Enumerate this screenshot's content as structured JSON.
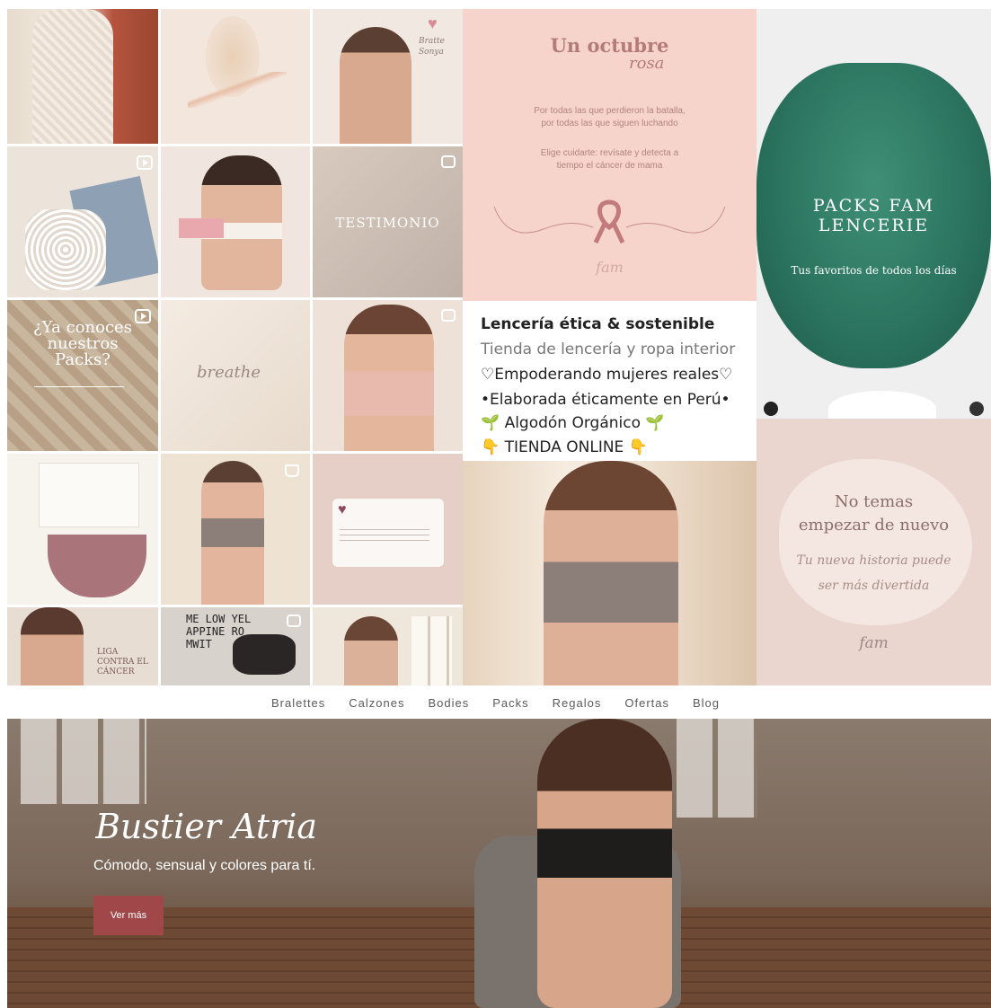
{
  "grid_text": {
    "testimonio": "TESTIMONIO",
    "packs_q": "¿Ya conoces nuestros Packs?",
    "breathe": "breathe",
    "liga": "LIGA CONTRA EL CÁNCER",
    "signature": "Bratte Sonya",
    "mag_words": "ME LOW YEL APPINE RO MWIT"
  },
  "octubre": {
    "title": "Un octubre",
    "script": "rosa",
    "line1": "Por todas las que perdieron la batalla,",
    "line2": "por todas las que siguen luchando",
    "line3": "Elige cuidarte: revísate y detecta a",
    "line4": "tiempo el cáncer de mama",
    "logo": "fam"
  },
  "bio": {
    "line1": "Lencería ética & sostenible",
    "line2": "Tienda de lencería y ropa interior",
    "line3": "♡Empoderando mujeres reales♡",
    "line4": "•Elaborada éticamente en Perú•",
    "line5": "🌱 Algodón Orgánico 🌱",
    "line6": "👇 TIENDA ONLINE 👇"
  },
  "packs": {
    "title": "PACKS FAM LENCERIE",
    "subtitle": "Tus favoritos de todos los días"
  },
  "no_temas": {
    "title_line1": "No temas",
    "title_line2": "empezar de nuevo",
    "script_line1": "Tu nueva historia puede",
    "script_line2": "ser más divertida",
    "logo": "fam"
  },
  "nav": {
    "items": [
      "Bralettes",
      "Calzones",
      "Bodies",
      "Packs",
      "Regalos",
      "Ofertas",
      "Blog"
    ]
  },
  "hero": {
    "title": "Bustier Atria",
    "subtitle": "Cómodo, sensual y colores para tí.",
    "button": "Ver más"
  },
  "colors": {
    "accent_button": "#a0474a",
    "pink_panel": "#f6d4cb",
    "teal": "#2f7a63",
    "rose_panel": "#ead5cf"
  },
  "icons": [
    "reel-icon",
    "multi-photo-icon",
    "shopping-bag-icon",
    "ribbon-icon",
    "user-icon",
    "audio-icon",
    "heart-icon"
  ]
}
